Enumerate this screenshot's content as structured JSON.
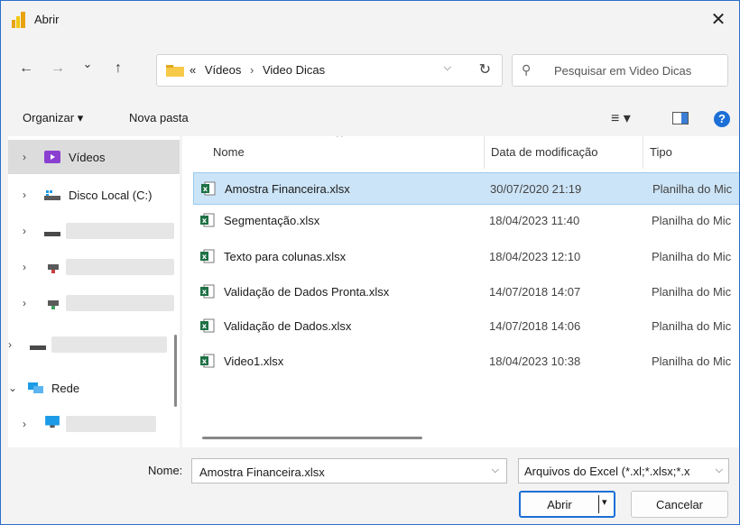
{
  "window": {
    "title": "Abrir",
    "close_glyph": "✕"
  },
  "nav": {
    "back": "←",
    "forward": "→",
    "recent": "⌄",
    "up": "↑",
    "breadcrumb": {
      "overflow": "«",
      "items": [
        "Vídeos",
        "Video Dicas"
      ],
      "separator": "›"
    },
    "address_dropdown": "⌵",
    "refresh": "↻",
    "search": {
      "icon": "search-icon",
      "placeholder": "Pesquisar em Video Dicas"
    }
  },
  "toolbar": {
    "organize": "Organizar ▾",
    "new_folder": "Nova pasta",
    "view_menu": "≡ ▾",
    "help": "?"
  },
  "sidebar": {
    "items": [
      {
        "label": "Vídeos",
        "icon": "videos-icon",
        "chevron": "›",
        "selected": true
      },
      {
        "label": "Disco Local (C:)",
        "icon": "drive-icon",
        "chevron": "›"
      },
      {
        "label": "",
        "icon": "drive-icon",
        "chevron": "›"
      },
      {
        "label": "",
        "icon": "network-drive-icon",
        "chevron": "›"
      },
      {
        "label": "",
        "icon": "network-drive-icon",
        "chevron": "›"
      },
      {
        "label": "",
        "icon": "drive-icon",
        "chevron": "›"
      },
      {
        "label": "Rede",
        "icon": "network-icon",
        "chevron": "⌄"
      },
      {
        "label": "",
        "icon": "computer-icon",
        "chevron": "›"
      }
    ]
  },
  "files": {
    "columns": {
      "name": "Nome",
      "sort_indicator": "^",
      "date": "Data de modificação",
      "type": "Tipo"
    },
    "rows": [
      {
        "name": "Amostra Financeira.xlsx",
        "date": "30/07/2020 21:19",
        "type": "Planilha do Mic",
        "selected": true
      },
      {
        "name": "Segmentação.xlsx",
        "date": "18/04/2023 11:40",
        "type": "Planilha do Mic"
      },
      {
        "name": "Texto para colunas.xlsx",
        "date": "18/04/2023 12:10",
        "type": "Planilha do Mic"
      },
      {
        "name": "Validação de Dados Pronta.xlsx",
        "date": "14/07/2018 14:07",
        "type": "Planilha do Mic"
      },
      {
        "name": "Validação de Dados.xlsx",
        "date": "14/07/2018 14:06",
        "type": "Planilha do Mic"
      },
      {
        "name": "Video1.xlsx",
        "date": "18/04/2023 10:38",
        "type": "Planilha do Mic"
      }
    ]
  },
  "footer": {
    "name_label": "Nome:",
    "name_value": "Amostra Financeira.xlsx",
    "filetype": "Arquivos do Excel (*.xl;*.xlsx;*.x",
    "dropdown_glyph": "⌵",
    "open_button": "Abrir",
    "open_arrow": "▾",
    "cancel_button": "Cancelar"
  },
  "colors": {
    "accent": "#1c6fd6",
    "selection": "#cce4f7",
    "excel_green": "#1e7145",
    "folder_yellow": "#f7c948"
  }
}
